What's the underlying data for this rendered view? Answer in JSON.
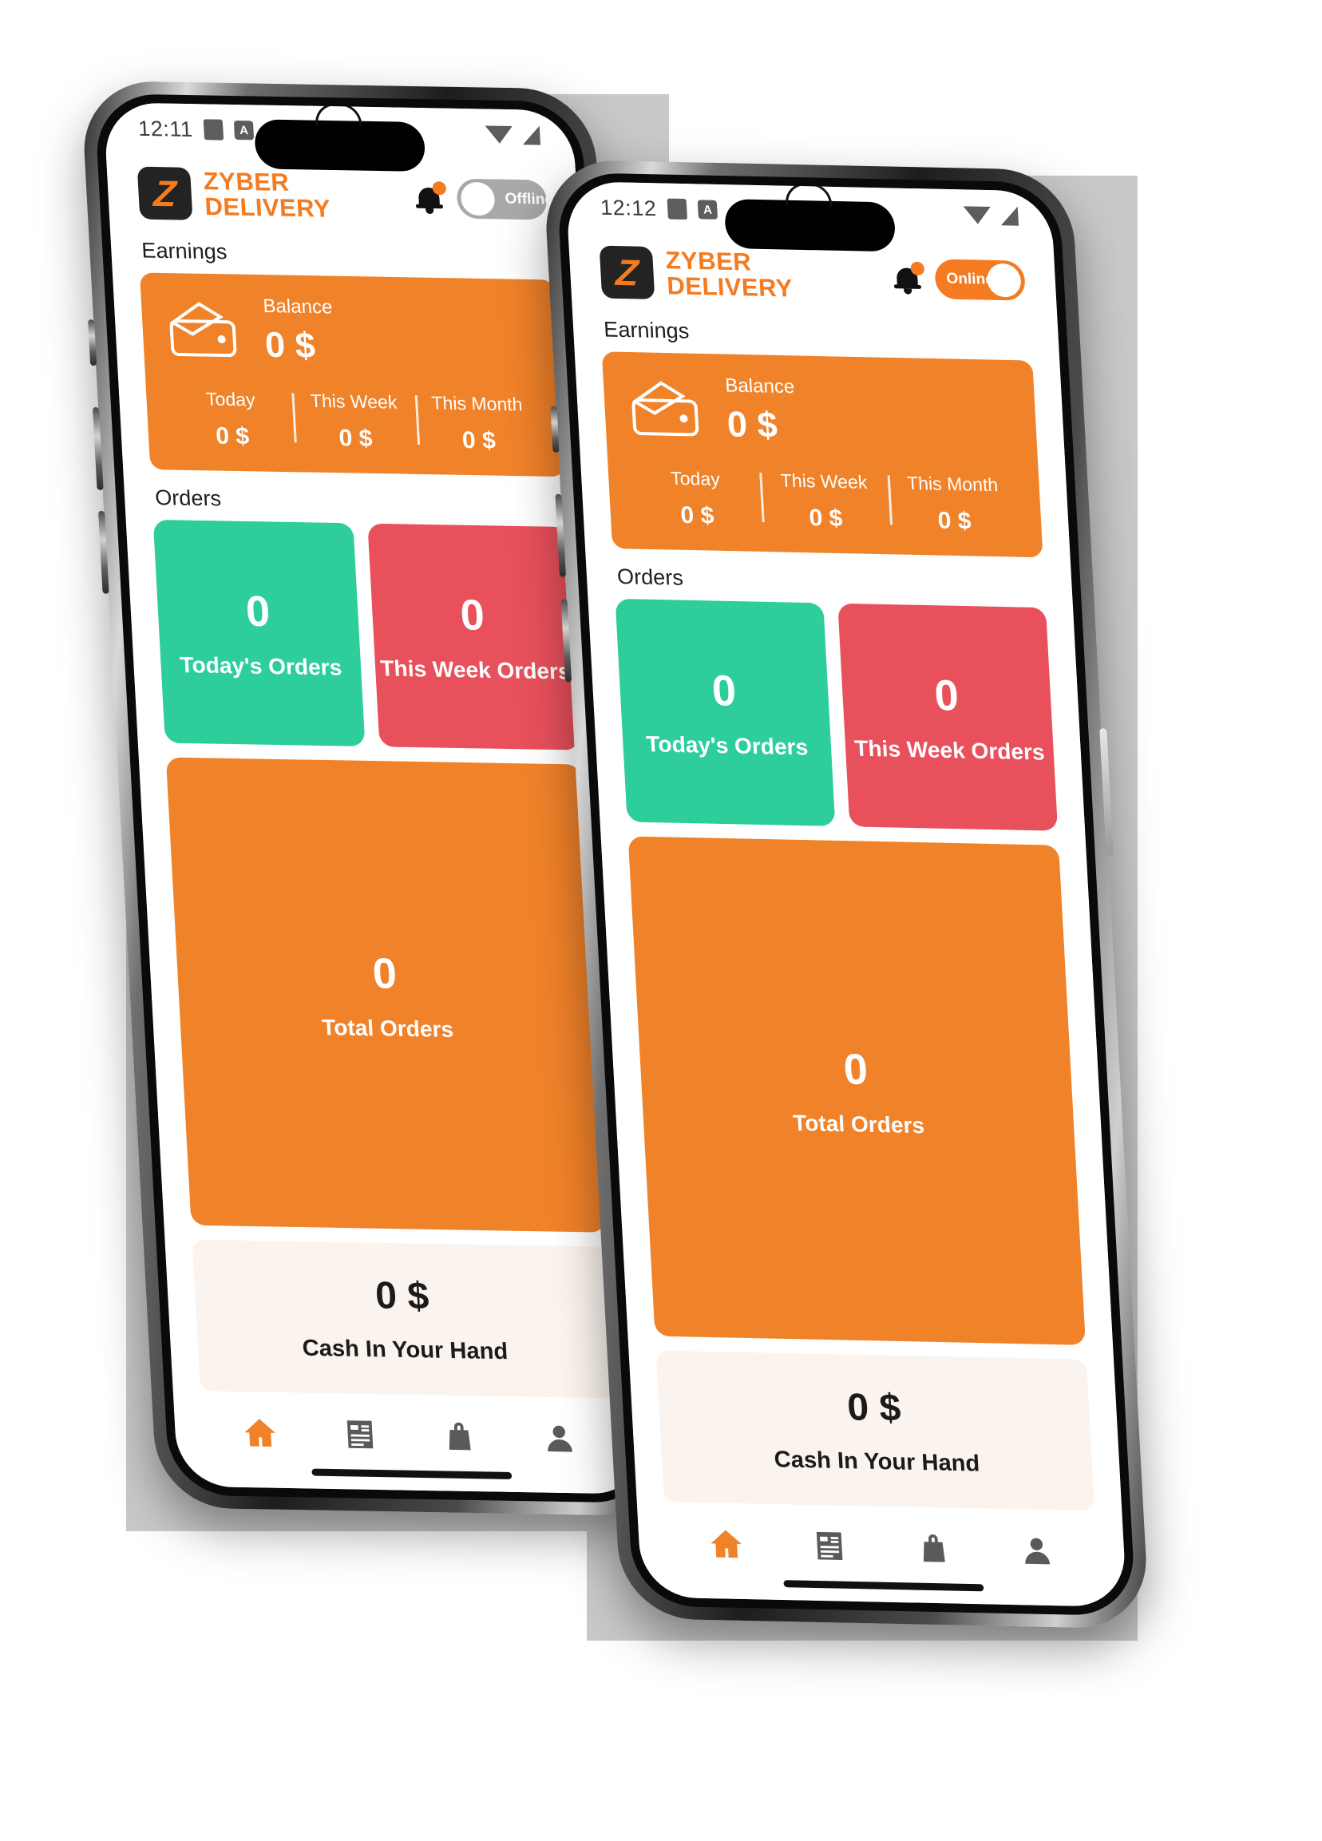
{
  "app": {
    "brand_line1": "ZYBER",
    "brand_line2": "DELIVERY",
    "logo_glyph": "Z"
  },
  "phones": [
    {
      "id": "back-phone",
      "status_bar": {
        "time": "12:11",
        "battery_icon": "battery-icon",
        "alarm_icon": "A",
        "wifi_icon": "wifi-icon",
        "signal_icon": "signal-icon"
      },
      "toggle": {
        "label": "Offline",
        "state": "off"
      }
    },
    {
      "id": "front-phone",
      "status_bar": {
        "time": "12:12",
        "battery_icon": "battery-icon",
        "alarm_icon": "A",
        "wifi_icon": "wifi-icon",
        "signal_icon": "signal-icon"
      },
      "toggle": {
        "label": "Online",
        "state": "on"
      }
    }
  ],
  "earnings": {
    "section_title": "Earnings",
    "balance_label": "Balance",
    "balance_value": "0 $",
    "stats": [
      {
        "label": "Today",
        "value": "0 $"
      },
      {
        "label": "This Week",
        "value": "0 $"
      },
      {
        "label": "This Month",
        "value": "0 $"
      }
    ]
  },
  "orders": {
    "section_title": "Orders",
    "tiles": [
      {
        "value": "0",
        "label": "Today's Orders",
        "color": "#2ECE9C"
      },
      {
        "value": "0",
        "label": "This Week Orders",
        "color": "#E8505B"
      },
      {
        "value": "0",
        "label": "Total Orders",
        "color": "#F0822A"
      }
    ]
  },
  "cash": {
    "value": "0 $",
    "label": "Cash In Your Hand"
  },
  "bottom_nav": [
    {
      "name": "home",
      "icon": "home-icon",
      "active": true
    },
    {
      "name": "orders",
      "icon": "list-icon",
      "active": false
    },
    {
      "name": "shop",
      "icon": "bag-icon",
      "active": false
    },
    {
      "name": "profile",
      "icon": "person-icon",
      "active": false
    }
  ],
  "colors": {
    "brand_orange": "#F47B20",
    "card_orange": "#F0822A",
    "green": "#2ECE9C",
    "red": "#E8505B",
    "cash_bg": "#FBF4EE"
  }
}
